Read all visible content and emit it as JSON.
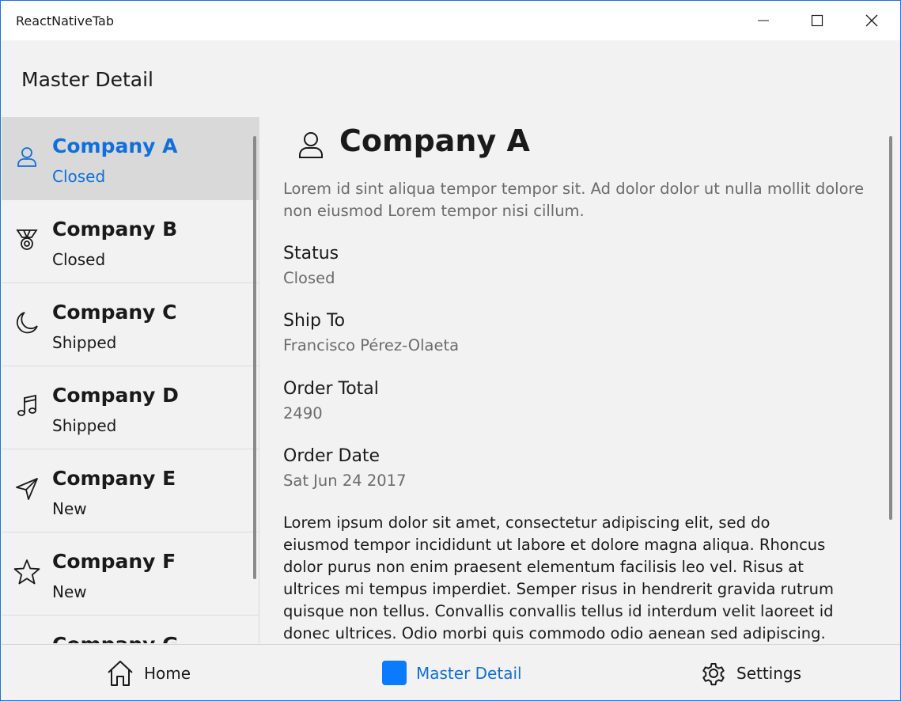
{
  "window": {
    "title": "ReactNativeTab",
    "controls": [
      "minimize-icon",
      "maximize-icon",
      "close-icon"
    ]
  },
  "header": {
    "title": "Master Detail"
  },
  "master": {
    "items": [
      {
        "name": "Company A",
        "status": "Closed",
        "icon": "person-icon",
        "selected": true
      },
      {
        "name": "Company B",
        "status": "Closed",
        "icon": "medal-icon"
      },
      {
        "name": "Company C",
        "status": "Shipped",
        "icon": "moon-icon"
      },
      {
        "name": "Company D",
        "status": "Shipped",
        "icon": "music-note-icon"
      },
      {
        "name": "Company E",
        "status": "New",
        "icon": "send-icon"
      },
      {
        "name": "Company F",
        "status": "New",
        "icon": "star-icon"
      },
      {
        "name": "Company G",
        "status": "",
        "icon": ""
      }
    ]
  },
  "detail": {
    "icon": "person-icon",
    "title": "Company A",
    "summary": "Lorem id sint aliqua tempor tempor sit. Ad dolor dolor ut nulla mollit dolore non eiusmod Lorem tempor nisi cillum.",
    "fields": [
      {
        "label": "Status",
        "value": "Closed"
      },
      {
        "label": "Ship To",
        "value": "Francisco Pérez-Olaeta"
      },
      {
        "label": "Order Total",
        "value": "2490"
      },
      {
        "label": "Order Date",
        "value": "Sat Jun 24 2017"
      }
    ],
    "body": "Lorem ipsum dolor sit amet, consectetur adipiscing elit, sed do eiusmod tempor incididunt ut labore et dolore magna aliqua. Rhoncus dolor purus non enim praesent elementum facilisis leo vel. Risus at ultrices mi tempus imperdiet. Semper risus in hendrerit gravida rutrum quisque non tellus. Convallis convallis tellus id interdum velit laoreet id donec ultrices. Odio morbi quis commodo odio aenean sed adipiscing. Amet nisl"
  },
  "tabs": [
    {
      "label": "Home",
      "icon": "home-icon"
    },
    {
      "label": "Master Detail",
      "icon": "square-icon",
      "active": true
    },
    {
      "label": "Settings",
      "icon": "gear-icon"
    }
  ],
  "colors": {
    "accent": "#0f6fde",
    "tab_square": "#0a7aff",
    "selected_row": "#d9d9d9",
    "background": "#f2f2f2"
  }
}
